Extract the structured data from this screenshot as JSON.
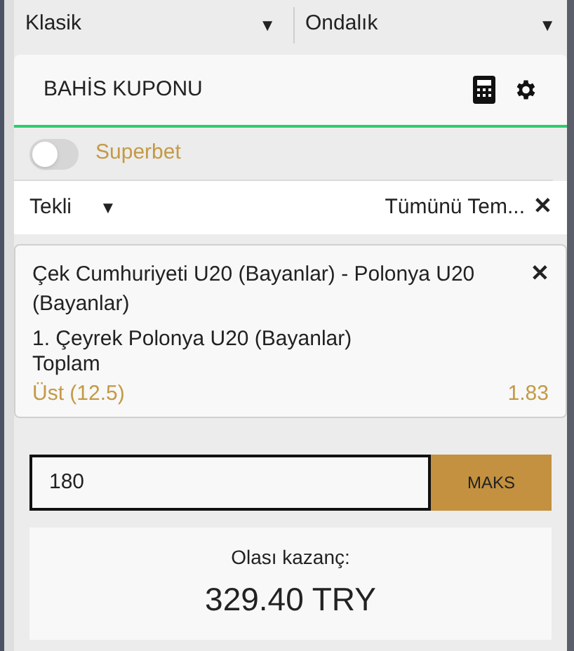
{
  "selectors": [
    {
      "value": "Klasik",
      "caret": "▼"
    },
    {
      "value": "Ondalık",
      "caret": "▼"
    }
  ],
  "header": {
    "title": "BAHİS KUPONU"
  },
  "superbet": {
    "label": "Superbet",
    "on": false
  },
  "bet_type": {
    "value": "Tekli",
    "caret": "▼",
    "clear_all": "Tümünü Tem...",
    "close": "✕"
  },
  "selections": [
    {
      "match": "Çek Cumhuriyeti U20 (Bayanlar) - Polonya U20 (Bayanlar)",
      "market": "1. Çeyrek Polonya U20 (Bayanlar) Toplam",
      "pick": "Üst (12.5)",
      "odds": "1.83",
      "close": "✕"
    }
  ],
  "stake": {
    "value": "180",
    "max_button": "MAKS"
  },
  "winnings": {
    "label": "Olası kazanç:",
    "amount": "329.40 TRY"
  }
}
